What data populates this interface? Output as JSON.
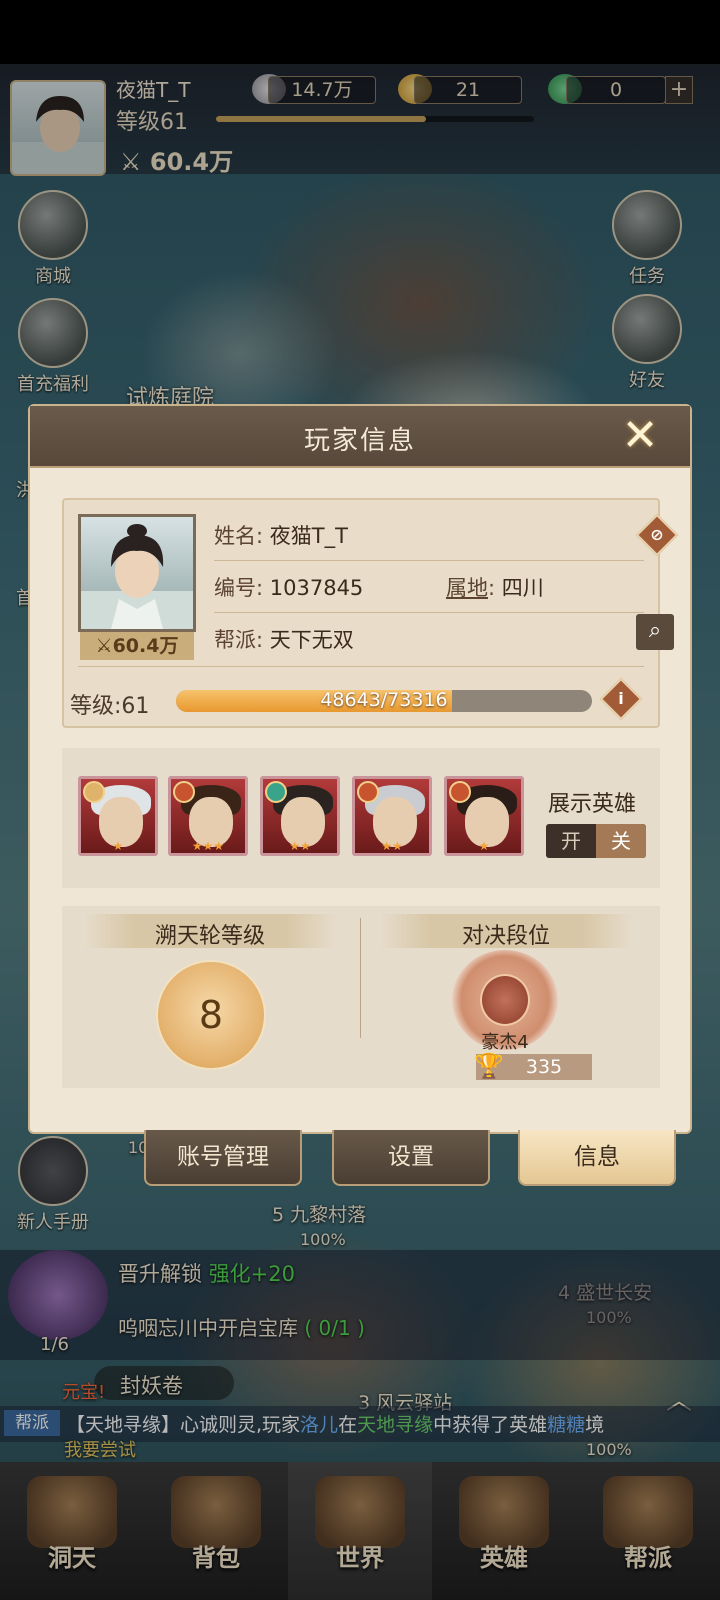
{
  "hud": {
    "player_name": "夜猫T_T",
    "level_text": "等级61",
    "exp_fraction": 0.66,
    "power": "60.4万",
    "silver": "14.7万",
    "gold": "21",
    "jade": "0",
    "plus_label": "+"
  },
  "left_menu": [
    {
      "label": "商城"
    },
    {
      "label": "首充福利"
    },
    {
      "label": "洪"
    },
    {
      "label": "首"
    }
  ],
  "right_menu": [
    {
      "label": "任务"
    },
    {
      "label": "好友"
    }
  ],
  "map_labels": {
    "trial": "试炼庭院",
    "village": "5 九黎村落",
    "village_pct": "100%",
    "changan": "4 盛世长安",
    "changan_pct": "100%",
    "station": "3 风云驿站",
    "station_pct": "100%",
    "misc_pct": "10",
    "bottom_pct": "100%"
  },
  "modal": {
    "title": "玩家信息",
    "close_label": "✕",
    "name_label": "姓名:",
    "name_value": "夜猫T_T",
    "id_label": "编号:",
    "id_value": "1037845",
    "region_label": "属地",
    "region_sep": ":",
    "region_value": "四川",
    "guild_label": "帮派:",
    "guild_value": "天下无双",
    "portrait_power": "60.4万",
    "level_label": "等级:61",
    "exp_current": 48643,
    "exp_max": 73316,
    "exp_text": "48643/73316",
    "show_heroes_label": "展示英雄",
    "toggle_on": "开",
    "toggle_off": "关",
    "wheel_title": "溯天轮等级",
    "wheel_level": "8",
    "duel_title": "对决段位",
    "rank_name": "豪杰4",
    "trophy_count": "335"
  },
  "heroes": [
    {
      "hair": "#dfe4e6",
      "badge": "#e0b36a",
      "stars": "★"
    },
    {
      "hair": "#3a2418",
      "badge": "#c7542f",
      "stars": "★★★"
    },
    {
      "hair": "#2a2320",
      "badge": "#3aa48a",
      "stars": "★★"
    },
    {
      "hair": "#c9ccd0",
      "badge": "#c7542f",
      "stars": "★★"
    },
    {
      "hair": "#2a1c16",
      "badge": "#c7542f",
      "stars": "★"
    }
  ],
  "tabs": [
    {
      "label": "账号管理"
    },
    {
      "label": "设置"
    },
    {
      "label": "信息"
    }
  ],
  "quest": {
    "newbie": "新人手册",
    "promo": "晋升解锁",
    "promo_bonus": "强化+20",
    "task": "呜咽忘川中开启宝库",
    "task_progress": "( 0/1 )",
    "boss_progress": "1/6",
    "scroll": "封妖卷",
    "alert": "元宝!"
  },
  "chat": {
    "tag": "帮派",
    "part1": "【天地寻缘】心诚则灵,玩家",
    "player": "洛儿",
    "part2": "在",
    "place": "天地寻缘",
    "part3": "中获得了英雄",
    "hero": "糖糖",
    "part4": "境",
    "sub": "我要尝试"
  },
  "bottom_nav": [
    {
      "label": "洞天"
    },
    {
      "label": "背包"
    },
    {
      "label": "世界"
    },
    {
      "label": "英雄"
    },
    {
      "label": "帮派"
    }
  ],
  "colors": {
    "accent_orange": "#e8982f",
    "modal_bg": "#efe6d6",
    "header_brown": "#5d4e40"
  }
}
